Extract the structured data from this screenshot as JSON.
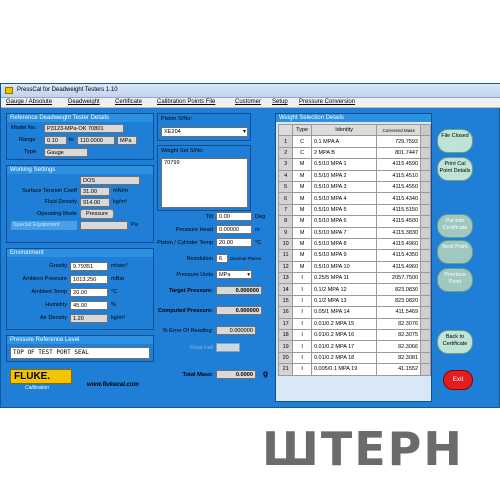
{
  "window": {
    "title": "PressCal for Deadweight Testers 1.10"
  },
  "menu": [
    "Gauge / Absolute",
    "Deadweight",
    "Certificate",
    "Calibration Points File",
    "Customer",
    "Setup",
    "Pressure Conversion"
  ],
  "ref_tester": {
    "header": "Reference Deadweight Tester Details",
    "model_label": "Model No.",
    "model_value": "P3123-MPa-OK 70801",
    "range_label": "Range",
    "range_from": "0.10",
    "range_to_label": "to",
    "range_to": "110.0000",
    "range_unit": "MPa",
    "type_label": "Type",
    "type_value": "Gauge"
  },
  "working": {
    "header": "Working Settings",
    "field1_value": "DOS",
    "stc_label": "Surface Tension Coeff",
    "stc_value": "31.00",
    "stc_unit": "mN/m",
    "fluid_label": "Fluid Density",
    "fluid_value": "914.00",
    "fluid_unit": "kg/m³",
    "mode_label": "Operating Mode",
    "mode_value": "Pressure",
    "eq_label": "Special Equipment",
    "eq_unit": "Pa"
  },
  "environment": {
    "header": "Environment",
    "gravity_label": "Gravity",
    "gravity_value": "9.79351",
    "gravity_unit": "m/sec²",
    "amb_p_label": "Ambient Pressure",
    "amb_p_value": "1013.250",
    "amb_p_unit": "mBar",
    "amb_t_label": "Ambient Temp",
    "amb_t_value": "20.00",
    "amb_t_unit": "°C",
    "hum_label": "Humidity",
    "hum_value": "45.00",
    "hum_unit": "%",
    "air_label": "Air Density",
    "air_value": "1.20",
    "air_unit": "kg/m³"
  },
  "pressure_ref": {
    "header": "Pressure Reference Level",
    "value": "TOP OF TEST PORT SEAL"
  },
  "brand": {
    "logo": "FLUKE.",
    "sub": "Calibration",
    "url": "www.flukecal.com"
  },
  "piston": {
    "sn_label": "Piston S/No:",
    "sn_value": "XE204",
    "ws_label": "Weight Set S/No:",
    "ws_value": "70799"
  },
  "calc": {
    "tilt_label": "Tilt",
    "tilt_value": "0.00",
    "tilt_unit": "Deg",
    "head_label": "Pressure Head",
    "head_value": "0.00000",
    "head_unit": "m",
    "temp_label": "Piston / Cylinder Temp",
    "temp_value": "20.00",
    "temp_unit": "°C",
    "res_label": "Resolution",
    "res_value": "6",
    "res_unit": "Decimal Places",
    "units_label": "Pressure Units",
    "units_value": "MPa",
    "target_label": "Target Pressure:",
    "target_value": "0.000000",
    "computed_label": "Computed Pressure:",
    "computed_value": "0.000000",
    "err_label": "% Error Of Reading:",
    "err_value": "0.000000",
    "float_label": "Float Fall",
    "mass_label": "Total Mass:",
    "mass_value": "0.0000",
    "mass_unit": "g"
  },
  "weights": {
    "header": "Weight Selection Details",
    "columns": [
      "Type",
      "Identity",
      "Corrected Mass"
    ],
    "rows": [
      {
        "n": "1",
        "type": "C",
        "id": "0.1 MPA A",
        "mass": "729.7592"
      },
      {
        "n": "2",
        "type": "C",
        "id": "2 MPA B",
        "mass": "801.7447"
      },
      {
        "n": "3",
        "type": "M",
        "id": "0.5/10 MPA 1",
        "mass": "4115.4590"
      },
      {
        "n": "4",
        "type": "M",
        "id": "0.5/10 MPA 2",
        "mass": "4115.4510"
      },
      {
        "n": "5",
        "type": "M",
        "id": "0.5/10 MPA 3",
        "mass": "4115.4550"
      },
      {
        "n": "6",
        "type": "M",
        "id": "0.5/10 MPA 4",
        "mass": "4115.4340"
      },
      {
        "n": "7",
        "type": "M",
        "id": "0.5/10 MPA 5",
        "mass": "4115.5150"
      },
      {
        "n": "8",
        "type": "M",
        "id": "0.5/10 MPA 6",
        "mass": "4115.4500"
      },
      {
        "n": "9",
        "type": "M",
        "id": "0.5/10 MPA 7",
        "mass": "4115.3830"
      },
      {
        "n": "10",
        "type": "M",
        "id": "0.5/10 MPA 8",
        "mass": "4115.4960"
      },
      {
        "n": "11",
        "type": "M",
        "id": "0.5/10 MPA 9",
        "mass": "4115.4350"
      },
      {
        "n": "12",
        "type": "M",
        "id": "0.5/10 MPA 10",
        "mass": "4115.4960"
      },
      {
        "n": "13",
        "type": "I",
        "id": "0.25/5 MPA 11",
        "mass": "2057.7500"
      },
      {
        "n": "14",
        "type": "I",
        "id": "0.1/2 MPA 12",
        "mass": "823.0830"
      },
      {
        "n": "15",
        "type": "I",
        "id": "0.1/2 MPA 13",
        "mass": "823.0820"
      },
      {
        "n": "16",
        "type": "I",
        "id": "0.05/1 MPA 14",
        "mass": "411.5469"
      },
      {
        "n": "17",
        "type": "I",
        "id": "0.01/0.2 MPA 15",
        "mass": "82.3076"
      },
      {
        "n": "18",
        "type": "I",
        "id": "0.01/0.2 MPA 16",
        "mass": "82.3075"
      },
      {
        "n": "19",
        "type": "I",
        "id": "0.01/0.2 MPA 17",
        "mass": "82.3066"
      },
      {
        "n": "20",
        "type": "I",
        "id": "0.01/0.2 MPA 18",
        "mass": "82.3081"
      },
      {
        "n": "21",
        "type": "I",
        "id": "0.005/0.1 MPA 19",
        "mass": "41.1552"
      }
    ]
  },
  "buttons": {
    "file": "File Closed",
    "print": "Print Cal Point Details",
    "putcert": "Put Into Certificate",
    "next": "Next Point",
    "prev": "Previous Point",
    "back": "Back to Certificate",
    "exit": "Exit"
  },
  "watermark": "ШТЕРН"
}
